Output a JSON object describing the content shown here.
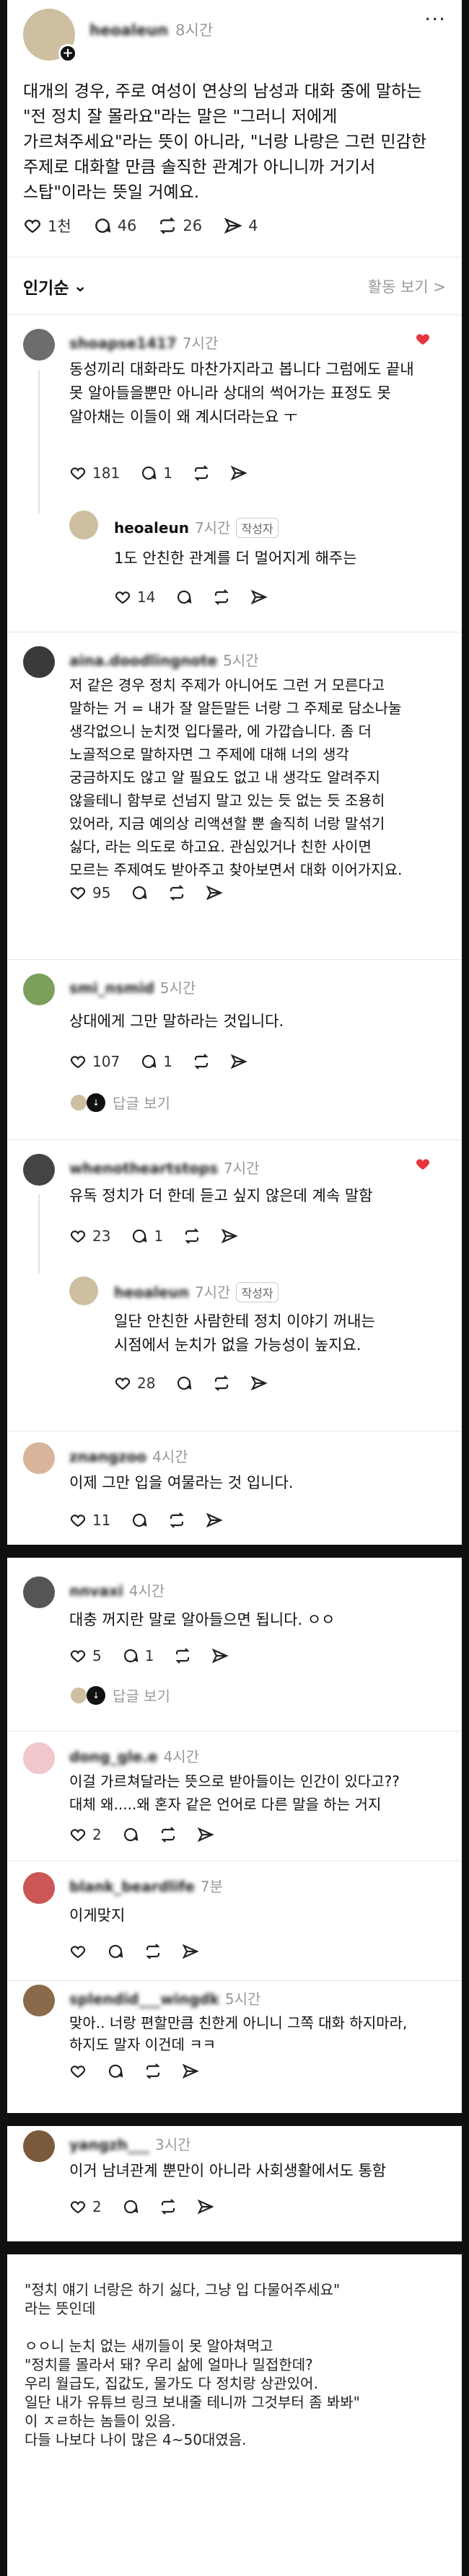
{
  "post": {
    "author": "heoaleun",
    "time": "8시간",
    "more": "···",
    "lines": [
      "대개의 경우, 주로 여성이 연상의 남성과 대화 중에 말하는",
      "\"전 정치 잘 몰라요\"라는 말은 \"그러니 저에게",
      "가르쳐주세요\"라는 뜻이 아니라, \"너랑 나랑은 그런 민감한",
      "주제로 대화할 만큼 솔직한 관계가 아니니까 거기서",
      "스탑\"이라는 뜻일 거예요."
    ],
    "likes": "1천",
    "comments": "46",
    "reposts": "26",
    "shares": "4"
  },
  "sort": {
    "label": "인기순",
    "right": "활동 보기 >"
  },
  "comments": [
    {
      "author": "shoapse1417",
      "time": "7시간",
      "lines": [
        "동성끼리 대화라도 마찬가지라고 봅니다 그럼에도 끝내",
        "못 알아들을뿐만 아니라 상대의 썩어가는 표정도 못",
        "알아채는 이들이 왜 계시더라는요 ㅜ"
      ],
      "likes": "181",
      "comments": "1",
      "reposts": "",
      "shares": ""
    },
    {
      "author": "heoaleun",
      "time": "7시간",
      "badge": "작성자",
      "lines": [
        "1도 안친한 관계를 더 멀어지게 해주는"
      ],
      "likes": "14",
      "comments": "",
      "reposts": "",
      "shares": ""
    },
    {
      "author": "aina.doodlingnote",
      "time": "5시간",
      "lines": [
        "저 같은 경우 정치 주제가 아니어도 그런 거 모른다고",
        "말하는 거 = 내가 잘 알든말든 너랑 그 주제로 담소나눌",
        "생각없으니 눈치껏 입다물라, 에 가깝습니다. 좀 더",
        "노골적으로 말하자면 그 주제에 대해 너의 생각",
        "궁금하지도 않고 알 필요도 없고 내 생각도 알려주지",
        "않을테니 함부로 선넘지 말고 있는 듯 없는 듯 조용히",
        "있어라, 지금 예의상 리액션할 뿐 솔직히 너랑 말섞기",
        "싫다, 라는 의도로 하고요. 관심있거나 친한 사이면",
        "모르는 주제여도 받아주고 찾아보면서 대화 이어가지요."
      ],
      "likes": "95",
      "comments": "",
      "reposts": "",
      "shares": ""
    },
    {
      "author": "smi_nsmid",
      "time": "5시간",
      "lines": [
        "상대에게 그만 말하라는 것입니다."
      ],
      "likes": "107",
      "comments": "1",
      "reposts": "",
      "shares": "",
      "reply": "답글 보기"
    },
    {
      "author": "whenotheartstops",
      "time": "7시간",
      "lines": [
        "유독 정치가 더 한데 듣고 싶지 않은데 계속 말함"
      ],
      "likes": "23",
      "comments": "1",
      "reposts": "",
      "shares": ""
    },
    {
      "author": "heoaleun",
      "time": "7시간",
      "badge": "작성자",
      "lines": [
        "일단 안친한 사람한테 정치 이야기 꺼내는",
        "시점에서 눈치가 없을 가능성이 높지요."
      ],
      "likes": "28",
      "comments": "",
      "reposts": "",
      "shares": ""
    },
    {
      "author": "znangzoo",
      "time": "4시간",
      "lines": [
        "이제 그만 입을 여물라는 것 입니다."
      ],
      "likes": "11",
      "comments": "",
      "reposts": "",
      "shares": ""
    }
  ],
  "comments2": [
    {
      "author": "nnvaxi",
      "time": "4시간",
      "lines": [
        "대충 꺼지란 말로 알아들으면 됩니다. ㅇㅇ"
      ],
      "likes": "5",
      "comments": "1",
      "reposts": "",
      "shares": "",
      "reply": "답글 보기"
    },
    {
      "author": "dong_gle.e",
      "time": "4시간",
      "lines": [
        "이걸 가르쳐달라는 뜻으로 받아들이는 인간이 있다고??",
        "대체 왜.....왜 혼자 같은 언어로 다른 말을 하는 거지"
      ],
      "likes": "2",
      "comments": "",
      "reposts": "",
      "shares": ""
    },
    {
      "author": "blank_beardlife",
      "time": "7분",
      "lines": [
        "이게맞지"
      ],
      "likes": "",
      "comments": "",
      "reposts": "",
      "shares": ""
    },
    {
      "author": "splendid___wingdk",
      "time": "5시간",
      "lines": [
        "맞아.. 너랑 편할만큼 친한게 아니니 그쪽 대화 하지마라,",
        "하지도 말자 이건데 ㅋㅋ"
      ],
      "likes": "",
      "comments": "",
      "reposts": "",
      "shares": ""
    },
    {
      "author": "yangzh___",
      "time": "3시간",
      "lines": [
        "이거 남녀관계 뿐만이 아니라 사회생활에서도 통함"
      ],
      "likes": "2",
      "comments": "",
      "reposts": "",
      "shares": ""
    }
  ],
  "textblock": [
    "\"정치 얘기 너랑은 하기 싫다, 그냥 입 다물어주세요\"",
    "라는 뜻인데",
    "",
    "ㅇㅇ니 눈치 없는 새끼들이 못 알아쳐먹고",
    "\"정치를 몰라서 돼? 우리 삶에 얼마나 밀접한데?",
    "우리 월급도, 집값도, 물가도 다 정치랑 상관있어.",
    "일단 내가 유튜브 링크 보내줄 테니까 그것부터 좀 봐봐\"",
    "이 ㅈㄹ하는 놈들이 있음.",
    "다들 나보다 나이 많은 4~50대였음."
  ]
}
